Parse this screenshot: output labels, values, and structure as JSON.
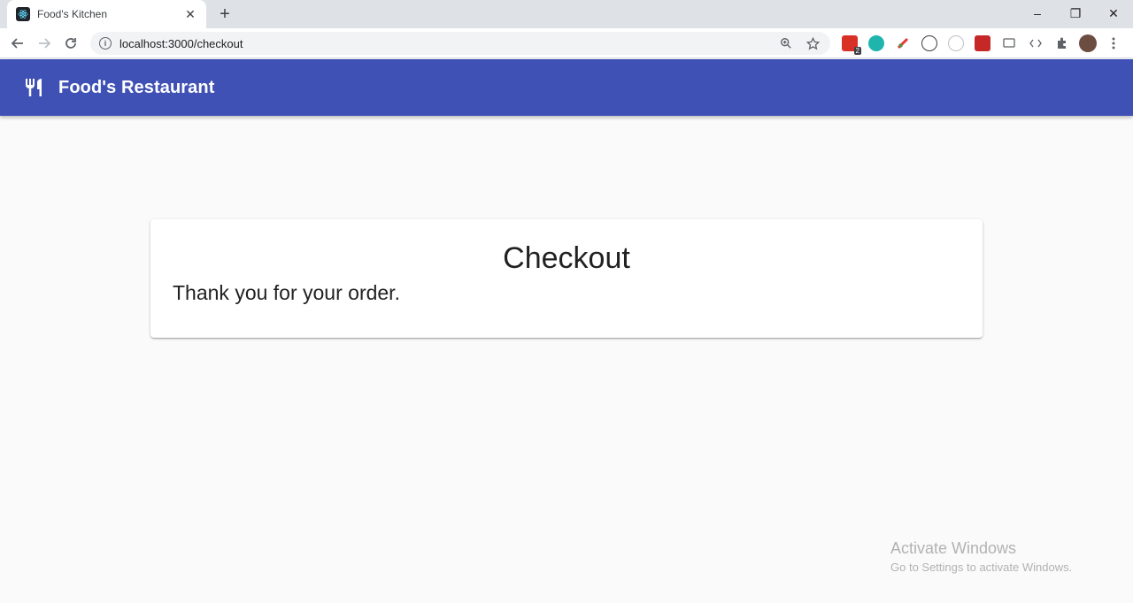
{
  "browser": {
    "tab": {
      "title": "Food's Kitchen",
      "close_glyph": "✕",
      "favicon": "react-icon"
    },
    "new_tab_glyph": "+",
    "window_controls": {
      "minimize": "–",
      "restore": "❐",
      "close": "✕"
    },
    "url": "localhost:3000/checkout",
    "extension_badge": "2"
  },
  "appbar": {
    "brand_icon": "restaurant-icon",
    "title": "Food's Restaurant",
    "color": "#3f51b5"
  },
  "card": {
    "title": "Checkout",
    "message": "Thank you for your order."
  },
  "watermark": {
    "title": "Activate Windows",
    "subtitle": "Go to Settings to activate Windows."
  }
}
